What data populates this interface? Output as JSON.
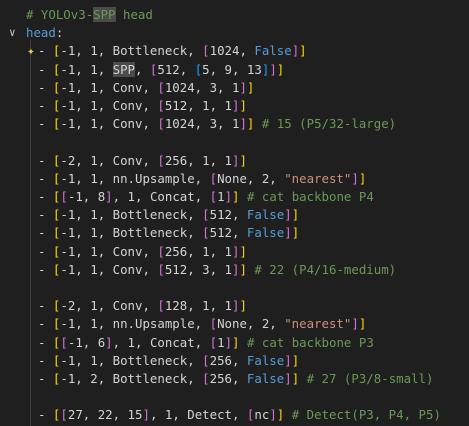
{
  "editor": {
    "lines": [
      {
        "t": [
          [
            "# YOLOv3-",
            "comment"
          ],
          [
            "SPP",
            "comment hl"
          ],
          [
            " head",
            "comment"
          ]
        ]
      },
      {
        "chevron": "chevron-down",
        "t": [
          [
            "head",
            "key"
          ],
          [
            ":",
            "punct"
          ]
        ]
      },
      {
        "sparkle": true,
        "t": [
          [
            "- ",
            "dash"
          ],
          [
            "[",
            "br1"
          ],
          [
            "-1, 1, Bottleneck, ",
            "plain"
          ],
          [
            "[",
            "br2"
          ],
          [
            "1024, ",
            "plain"
          ],
          [
            "False",
            "bool"
          ],
          [
            "]",
            "br2"
          ],
          [
            "]",
            "br1"
          ]
        ]
      },
      {
        "t": [
          [
            "- ",
            "dash"
          ],
          [
            "[",
            "br1"
          ],
          [
            "-1, 1, ",
            "plain"
          ],
          [
            "SPP",
            "plain hl"
          ],
          [
            ", ",
            "plain"
          ],
          [
            "[",
            "br2"
          ],
          [
            "512, ",
            "plain"
          ],
          [
            "[",
            "br3"
          ],
          [
            "5, 9, 13",
            "plain"
          ],
          [
            "]",
            "br3"
          ],
          [
            "]",
            "br2"
          ],
          [
            "]",
            "br1"
          ]
        ]
      },
      {
        "t": [
          [
            "- ",
            "dash"
          ],
          [
            "[",
            "br1"
          ],
          [
            "-1, 1, Conv, ",
            "plain"
          ],
          [
            "[",
            "br2"
          ],
          [
            "1024, 3, 1",
            "plain"
          ],
          [
            "]",
            "br2"
          ],
          [
            "]",
            "br1"
          ]
        ]
      },
      {
        "t": [
          [
            "- ",
            "dash"
          ],
          [
            "[",
            "br1"
          ],
          [
            "-1, 1, Conv, ",
            "plain"
          ],
          [
            "[",
            "br2"
          ],
          [
            "512, 1, 1",
            "plain"
          ],
          [
            "]",
            "br2"
          ],
          [
            "]",
            "br1"
          ]
        ]
      },
      {
        "t": [
          [
            "- ",
            "dash"
          ],
          [
            "[",
            "br1"
          ],
          [
            "-1, 1, Conv, ",
            "plain"
          ],
          [
            "[",
            "br2"
          ],
          [
            "1024, 3, 1",
            "plain"
          ],
          [
            "]",
            "br2"
          ],
          [
            "]",
            "br1"
          ],
          [
            " # 15 (P5/32-large)",
            "comment"
          ]
        ]
      },
      {
        "t": []
      },
      {
        "t": [
          [
            "- ",
            "dash"
          ],
          [
            "[",
            "br1"
          ],
          [
            "-2, 1, Conv, ",
            "plain"
          ],
          [
            "[",
            "br2"
          ],
          [
            "256, 1, 1",
            "plain"
          ],
          [
            "]",
            "br2"
          ],
          [
            "]",
            "br1"
          ]
        ]
      },
      {
        "t": [
          [
            "- ",
            "dash"
          ],
          [
            "[",
            "br1"
          ],
          [
            "-1, 1, nn.Upsample, ",
            "plain"
          ],
          [
            "[",
            "br2"
          ],
          [
            "None, 2, ",
            "plain"
          ],
          [
            "\"nearest\"",
            "str"
          ],
          [
            "]",
            "br2"
          ],
          [
            "]",
            "br1"
          ]
        ]
      },
      {
        "t": [
          [
            "- ",
            "dash"
          ],
          [
            "[",
            "br1"
          ],
          [
            "[",
            "br2"
          ],
          [
            "-1, 8",
            "plain"
          ],
          [
            "]",
            "br2"
          ],
          [
            ", 1, Concat, ",
            "plain"
          ],
          [
            "[",
            "br2"
          ],
          [
            "1",
            "plain"
          ],
          [
            "]",
            "br2"
          ],
          [
            "]",
            "br1"
          ],
          [
            " # cat backbone P4",
            "comment"
          ]
        ]
      },
      {
        "t": [
          [
            "- ",
            "dash"
          ],
          [
            "[",
            "br1"
          ],
          [
            "-1, 1, Bottleneck, ",
            "plain"
          ],
          [
            "[",
            "br2"
          ],
          [
            "512, ",
            "plain"
          ],
          [
            "False",
            "bool"
          ],
          [
            "]",
            "br2"
          ],
          [
            "]",
            "br1"
          ]
        ]
      },
      {
        "t": [
          [
            "- ",
            "dash"
          ],
          [
            "[",
            "br1"
          ],
          [
            "-1, 1, Bottleneck, ",
            "plain"
          ],
          [
            "[",
            "br2"
          ],
          [
            "512, ",
            "plain"
          ],
          [
            "False",
            "bool"
          ],
          [
            "]",
            "br2"
          ],
          [
            "]",
            "br1"
          ]
        ]
      },
      {
        "t": [
          [
            "- ",
            "dash"
          ],
          [
            "[",
            "br1"
          ],
          [
            "-1, 1, Conv, ",
            "plain"
          ],
          [
            "[",
            "br2"
          ],
          [
            "256, 1, 1",
            "plain"
          ],
          [
            "]",
            "br2"
          ],
          [
            "]",
            "br1"
          ]
        ]
      },
      {
        "t": [
          [
            "- ",
            "dash"
          ],
          [
            "[",
            "br1"
          ],
          [
            "-1, 1, Conv, ",
            "plain"
          ],
          [
            "[",
            "br2"
          ],
          [
            "512, 3, 1",
            "plain"
          ],
          [
            "]",
            "br2"
          ],
          [
            "]",
            "br1"
          ],
          [
            " # 22 (P4/16-medium)",
            "comment"
          ]
        ]
      },
      {
        "t": []
      },
      {
        "t": [
          [
            "- ",
            "dash"
          ],
          [
            "[",
            "br1"
          ],
          [
            "-2, 1, Conv, ",
            "plain"
          ],
          [
            "[",
            "br2"
          ],
          [
            "128, 1, 1",
            "plain"
          ],
          [
            "]",
            "br2"
          ],
          [
            "]",
            "br1"
          ]
        ]
      },
      {
        "t": [
          [
            "- ",
            "dash"
          ],
          [
            "[",
            "br1"
          ],
          [
            "-1, 1, nn.Upsample, ",
            "plain"
          ],
          [
            "[",
            "br2"
          ],
          [
            "None, 2, ",
            "plain"
          ],
          [
            "\"nearest\"",
            "str"
          ],
          [
            "]",
            "br2"
          ],
          [
            "]",
            "br1"
          ]
        ]
      },
      {
        "t": [
          [
            "- ",
            "dash"
          ],
          [
            "[",
            "br1"
          ],
          [
            "[",
            "br2"
          ],
          [
            "-1, 6",
            "plain"
          ],
          [
            "]",
            "br2"
          ],
          [
            ", 1, Concat, ",
            "plain"
          ],
          [
            "[",
            "br2"
          ],
          [
            "1",
            "plain"
          ],
          [
            "]",
            "br2"
          ],
          [
            "]",
            "br1"
          ],
          [
            " # cat backbone P3",
            "comment"
          ]
        ]
      },
      {
        "t": [
          [
            "- ",
            "dash"
          ],
          [
            "[",
            "br1"
          ],
          [
            "-1, 1, Bottleneck, ",
            "plain"
          ],
          [
            "[",
            "br2"
          ],
          [
            "256, ",
            "plain"
          ],
          [
            "False",
            "bool"
          ],
          [
            "]",
            "br2"
          ],
          [
            "]",
            "br1"
          ]
        ]
      },
      {
        "t": [
          [
            "- ",
            "dash"
          ],
          [
            "[",
            "br1"
          ],
          [
            "-1, 2, Bottleneck, ",
            "plain"
          ],
          [
            "[",
            "br2"
          ],
          [
            "256, ",
            "plain"
          ],
          [
            "False",
            "bool"
          ],
          [
            "]",
            "br2"
          ],
          [
            "]",
            "br1"
          ],
          [
            " # 27 (P3/8-small)",
            "comment"
          ]
        ]
      },
      {
        "t": []
      },
      {
        "t": [
          [
            "- ",
            "dash"
          ],
          [
            "[",
            "br1"
          ],
          [
            "[",
            "br2"
          ],
          [
            "27, 22, 15",
            "plain"
          ],
          [
            "]",
            "br2"
          ],
          [
            ", 1, Detect, ",
            "plain"
          ],
          [
            "[",
            "br2"
          ],
          [
            "nc",
            "plain"
          ],
          [
            "]",
            "br2"
          ],
          [
            "]",
            "br1"
          ],
          [
            " # Detect(P3, P4, P5)",
            "comment"
          ]
        ]
      }
    ]
  },
  "icons": {
    "chevron": "chevron-down-icon",
    "sparkle": "sparkle-icon"
  },
  "colors": {
    "background": "#1f1f1f",
    "comment": "#6a9955",
    "key": "#569cd6",
    "bracket1": "#ffd700",
    "bracket2": "#da70d6",
    "bracket3": "#179fff",
    "string": "#ce9178"
  }
}
